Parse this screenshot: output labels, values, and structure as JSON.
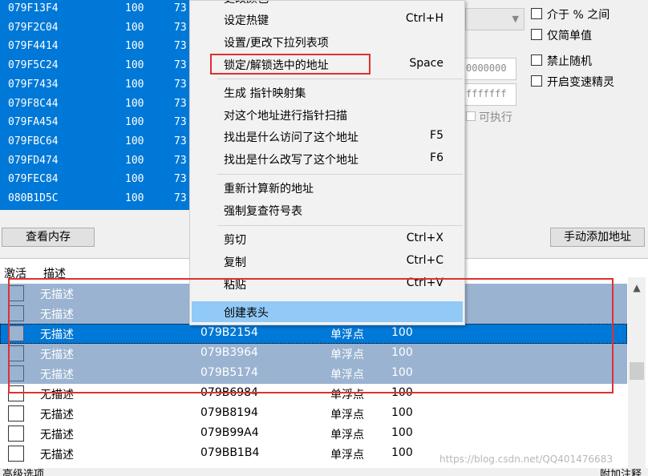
{
  "scan_results": [
    {
      "address": "079F13F4",
      "value": "100",
      "previous": "73"
    },
    {
      "address": "079F2C04",
      "value": "100",
      "previous": "73"
    },
    {
      "address": "079F4414",
      "value": "100",
      "previous": "73"
    },
    {
      "address": "079F5C24",
      "value": "100",
      "previous": "73"
    },
    {
      "address": "079F7434",
      "value": "100",
      "previous": "73"
    },
    {
      "address": "079F8C44",
      "value": "100",
      "previous": "73"
    },
    {
      "address": "079FA454",
      "value": "100",
      "previous": "73"
    },
    {
      "address": "079FBC64",
      "value": "100",
      "previous": "73"
    },
    {
      "address": "079FD474",
      "value": "100",
      "previous": "73"
    },
    {
      "address": "079FEC84",
      "value": "100",
      "previous": "73"
    },
    {
      "address": "080B1D5C",
      "value": "100",
      "previous": "73"
    }
  ],
  "scan_options": {
    "between_percent": "介于 % 之间",
    "simple_values_only": "仅简单值",
    "no_random": "禁止随机",
    "speedhack": "开启变速精灵",
    "memory_start": "0000000",
    "memory_stop": "fffffff",
    "executable": "可执行"
  },
  "buttons": {
    "view_memory": "查看内存",
    "add_address_manually": "手动添加地址"
  },
  "context_menu": {
    "items": [
      {
        "label": "更改颜色",
        "shortcut": ""
      },
      {
        "label": "设定热键",
        "shortcut": "Ctrl+H"
      },
      {
        "label": "设置/更改下拉列表项",
        "shortcut": ""
      },
      {
        "label": "锁定/解锁选中的地址",
        "shortcut": "Space"
      },
      {
        "label": "生成 指针映射集",
        "shortcut": ""
      },
      {
        "label": "对这个地址进行指针扫描",
        "shortcut": ""
      },
      {
        "label": "找出是什么访问了这个地址",
        "shortcut": "F5"
      },
      {
        "label": "找出是什么改写了这个地址",
        "shortcut": "F6"
      },
      {
        "label": "重新计算新的地址",
        "shortcut": ""
      },
      {
        "label": "强制复查符号表",
        "shortcut": ""
      },
      {
        "label": "剪切",
        "shortcut": "Ctrl+X"
      },
      {
        "label": "复制",
        "shortcut": "Ctrl+C"
      },
      {
        "label": "粘贴",
        "shortcut": "Ctrl+V"
      },
      {
        "label": "创建表头",
        "shortcut": ""
      }
    ]
  },
  "address_table": {
    "headers": {
      "active": "激活",
      "description": "描述"
    },
    "rows": [
      {
        "description": "无描述",
        "address": "",
        "type": "",
        "value": "",
        "state": "selected"
      },
      {
        "description": "无描述",
        "address": "",
        "type": "",
        "value": "",
        "state": "selected"
      },
      {
        "description": "无描述",
        "address": "079B2154",
        "type": "单浮点",
        "value": "100",
        "state": "current"
      },
      {
        "description": "无描述",
        "address": "079B3964",
        "type": "单浮点",
        "value": "100",
        "state": "selected"
      },
      {
        "description": "无描述",
        "address": "079B5174",
        "type": "单浮点",
        "value": "100",
        "state": "selected"
      },
      {
        "description": "无描述",
        "address": "079B6984",
        "type": "单浮点",
        "value": "100",
        "state": "normal"
      },
      {
        "description": "无描述",
        "address": "079B8194",
        "type": "单浮点",
        "value": "100",
        "state": "normal"
      },
      {
        "description": "无描述",
        "address": "079B99A4",
        "type": "单浮点",
        "value": "100",
        "state": "normal"
      },
      {
        "description": "无描述",
        "address": "079BB1B4",
        "type": "单浮点",
        "value": "100",
        "state": "normal"
      }
    ]
  },
  "status_bar": {
    "advanced_options": "高级选项",
    "table_extras": "附加注释"
  },
  "watermark": "https://blog.csdn.net/QQ401476683",
  "colors": {
    "selection_blue": "#0078d7",
    "multi_select": "#9ab3d1",
    "menu_highlight": "#91c9f7",
    "annotation_red": "#e03030"
  }
}
